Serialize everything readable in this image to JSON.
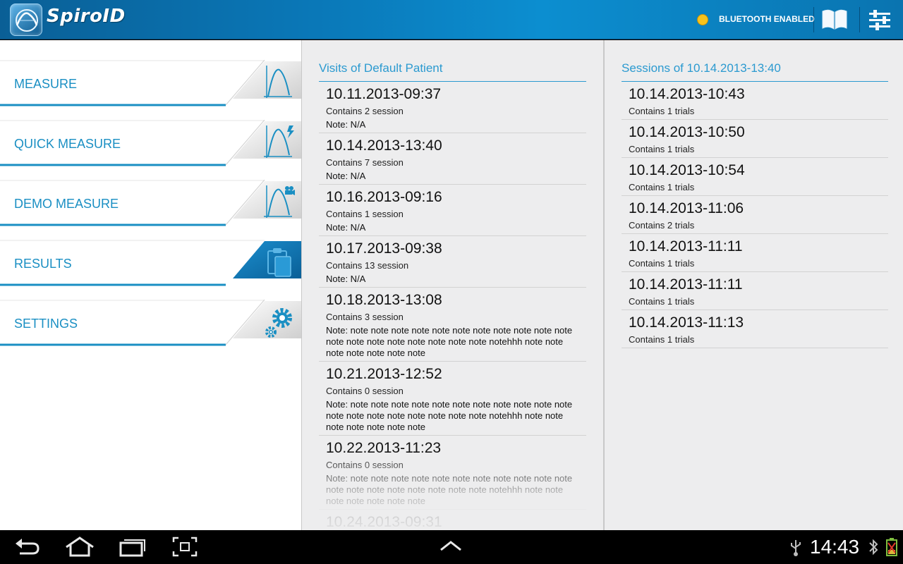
{
  "app": {
    "title": "SpiroID",
    "bluetooth_status": "BLUETOOTH ENABLED",
    "bluetooth_color": "#f7c21c",
    "accent_color": "#1a8fc3",
    "header_icons": [
      "book-icon",
      "sliders-icon"
    ]
  },
  "menu": {
    "items": [
      {
        "label": "MEASURE",
        "icon": "spirometry-curve-icon",
        "selected": false
      },
      {
        "label": "QUICK MEASURE",
        "icon": "spirometry-curve-lightning-icon",
        "selected": false
      },
      {
        "label": "DEMO MEASURE",
        "icon": "spirometry-curve-camera-icon",
        "selected": false
      },
      {
        "label": "RESULTS",
        "icon": "clipboard-icon",
        "selected": true
      },
      {
        "label": "SETTINGS",
        "icon": "gears-icon",
        "selected": false
      }
    ]
  },
  "visits": {
    "header": "Visits of Default Patient",
    "rows": [
      {
        "date": "10.11.2013-09:37",
        "sessions": "Contains 2 session",
        "note": "Note: N/A"
      },
      {
        "date": "10.14.2013-13:40",
        "sessions": "Contains 7 session",
        "note": "Note: N/A"
      },
      {
        "date": "10.16.2013-09:16",
        "sessions": "Contains 1 session",
        "note": "Note: N/A"
      },
      {
        "date": "10.17.2013-09:38",
        "sessions": "Contains 13 session",
        "note": "Note: N/A"
      },
      {
        "date": "10.18.2013-13:08",
        "sessions": "Contains 3 session",
        "note": "Note: note note note note note note note note note note note note note note note note note note note notehhh note note note note note note note"
      },
      {
        "date": "10.21.2013-12:52",
        "sessions": "Contains 0 session",
        "note": "Note: note note note note note note note note note note note note note note note note note note note notehhh note note note note note note note"
      },
      {
        "date": "10.22.2013-11:23",
        "sessions": "Contains 0 session",
        "note": "Note: note note note note note note note note note note note note note note note note note note note notehhh note note note note note note note"
      },
      {
        "date": "10.24.2013-09:31",
        "sessions": "",
        "note": ""
      }
    ]
  },
  "sessions": {
    "header": "Sessions of 10.14.2013-13:40",
    "rows": [
      {
        "date": "10.14.2013-10:43",
        "trials": "Contains 1 trials"
      },
      {
        "date": "10.14.2013-10:50",
        "trials": "Contains 1 trials"
      },
      {
        "date": "10.14.2013-10:54",
        "trials": "Contains 1 trials"
      },
      {
        "date": "10.14.2013-11:06",
        "trials": "Contains 2 trials"
      },
      {
        "date": "10.14.2013-11:11",
        "trials": "Contains 1 trials"
      },
      {
        "date": "10.14.2013-11:11",
        "trials": "Contains 1 trials"
      },
      {
        "date": "10.14.2013-11:13",
        "trials": "Contains 1 trials"
      }
    ]
  },
  "system": {
    "clock": "14:43",
    "nav_icons": [
      "back-icon",
      "home-icon",
      "recent-apps-icon",
      "screenshot-icon",
      "chevron-up-icon"
    ],
    "status_icons": [
      "usb-icon",
      "bluetooth-icon",
      "battery-icon"
    ]
  }
}
